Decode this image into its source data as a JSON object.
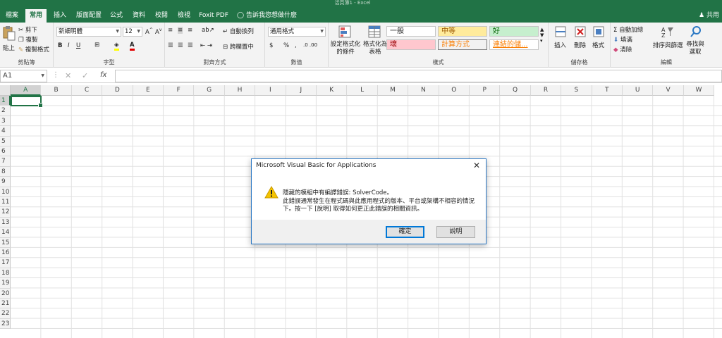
{
  "window": {
    "title": "活頁簿1 - Excel"
  },
  "tabs": [
    {
      "label": "檔案"
    },
    {
      "label": "常用"
    },
    {
      "label": "插入"
    },
    {
      "label": "版面配置"
    },
    {
      "label": "公式"
    },
    {
      "label": "資料"
    },
    {
      "label": "校閱"
    },
    {
      "label": "檢視"
    },
    {
      "label": "Foxit PDF"
    }
  ],
  "tellme": "告訴我您想做什麼",
  "share": "共用",
  "ribbon": {
    "clipboard": {
      "label": "剪貼簿",
      "paste": "貼上",
      "cut": "剪下",
      "copy": "複製",
      "format_painter": "複製格式"
    },
    "font": {
      "label": "字型",
      "name": "新細明體",
      "size": "12",
      "bold": "B",
      "italic": "I",
      "underline": "U",
      "font_color": "A"
    },
    "alignment": {
      "label": "對齊方式",
      "wrap": "自動換列",
      "merge": "跨欄置中"
    },
    "number": {
      "label": "數值",
      "format": "通用格式",
      "currency": "$",
      "percent": "%",
      "comma": ","
    },
    "styles": {
      "label": "樣式",
      "conditional": "設定格式化的條件",
      "cond_line1": "設定格式化",
      "cond_line2": "的條件",
      "table_line1": "格式化為",
      "table_line2": "表格",
      "normal": "一般",
      "neutral": "中等",
      "good": "好",
      "bad": "壞",
      "calculation": "計算方式",
      "link": "連結的儲..."
    },
    "cells": {
      "label": "儲存格",
      "insert": "插入",
      "delete": "刪除",
      "format": "格式"
    },
    "editing": {
      "label": "編輯",
      "autosum": "自動加總",
      "fill": "填滿",
      "clear": "清除",
      "sort": "排序與篩選",
      "find_line1": "尋找與",
      "find_line2": "選取"
    }
  },
  "formula_bar": {
    "name_box": "A1",
    "fx": "fx"
  },
  "columns": [
    "A",
    "B",
    "C",
    "D",
    "E",
    "F",
    "G",
    "H",
    "I",
    "J",
    "K",
    "L",
    "M",
    "N",
    "O",
    "P",
    "Q",
    "R",
    "S",
    "T",
    "U",
    "V",
    "W"
  ],
  "rows": [
    "1",
    "2",
    "3",
    "4",
    "5",
    "6",
    "7",
    "8",
    "9",
    "10",
    "11",
    "12",
    "13",
    "14",
    "15",
    "16",
    "17",
    "18",
    "19",
    "20",
    "21",
    "22",
    "23"
  ],
  "dialog": {
    "title": "Microsoft Visual Basic for Applications",
    "line1": "隱藏的模組中有編譯錯誤: SolverCode。",
    "line2": "此錯誤通常發生在程式碼與此應用程式的版本、平台或架構不相容的情況",
    "line3": "下。按一下 [說明] 取得如何更正此錯誤的相關資訊。",
    "ok": "確定",
    "help": "說明"
  },
  "colors": {
    "accent": "#217346",
    "dialog_border": "#2b78c4"
  }
}
